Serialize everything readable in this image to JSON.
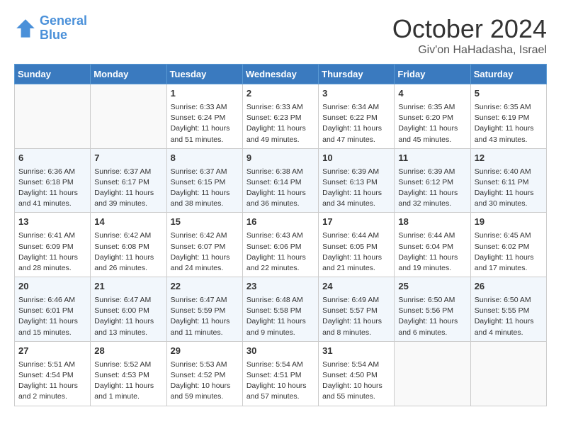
{
  "header": {
    "logo_line1": "General",
    "logo_line2": "Blue",
    "month_title": "October 2024",
    "location": "Giv'on HaHadasha, Israel"
  },
  "days_of_week": [
    "Sunday",
    "Monday",
    "Tuesday",
    "Wednesday",
    "Thursday",
    "Friday",
    "Saturday"
  ],
  "weeks": [
    [
      {
        "day": "",
        "info": ""
      },
      {
        "day": "",
        "info": ""
      },
      {
        "day": "1",
        "info": "Sunrise: 6:33 AM\nSunset: 6:24 PM\nDaylight: 11 hours and 51 minutes."
      },
      {
        "day": "2",
        "info": "Sunrise: 6:33 AM\nSunset: 6:23 PM\nDaylight: 11 hours and 49 minutes."
      },
      {
        "day": "3",
        "info": "Sunrise: 6:34 AM\nSunset: 6:22 PM\nDaylight: 11 hours and 47 minutes."
      },
      {
        "day": "4",
        "info": "Sunrise: 6:35 AM\nSunset: 6:20 PM\nDaylight: 11 hours and 45 minutes."
      },
      {
        "day": "5",
        "info": "Sunrise: 6:35 AM\nSunset: 6:19 PM\nDaylight: 11 hours and 43 minutes."
      }
    ],
    [
      {
        "day": "6",
        "info": "Sunrise: 6:36 AM\nSunset: 6:18 PM\nDaylight: 11 hours and 41 minutes."
      },
      {
        "day": "7",
        "info": "Sunrise: 6:37 AM\nSunset: 6:17 PM\nDaylight: 11 hours and 39 minutes."
      },
      {
        "day": "8",
        "info": "Sunrise: 6:37 AM\nSunset: 6:15 PM\nDaylight: 11 hours and 38 minutes."
      },
      {
        "day": "9",
        "info": "Sunrise: 6:38 AM\nSunset: 6:14 PM\nDaylight: 11 hours and 36 minutes."
      },
      {
        "day": "10",
        "info": "Sunrise: 6:39 AM\nSunset: 6:13 PM\nDaylight: 11 hours and 34 minutes."
      },
      {
        "day": "11",
        "info": "Sunrise: 6:39 AM\nSunset: 6:12 PM\nDaylight: 11 hours and 32 minutes."
      },
      {
        "day": "12",
        "info": "Sunrise: 6:40 AM\nSunset: 6:11 PM\nDaylight: 11 hours and 30 minutes."
      }
    ],
    [
      {
        "day": "13",
        "info": "Sunrise: 6:41 AM\nSunset: 6:09 PM\nDaylight: 11 hours and 28 minutes."
      },
      {
        "day": "14",
        "info": "Sunrise: 6:42 AM\nSunset: 6:08 PM\nDaylight: 11 hours and 26 minutes."
      },
      {
        "day": "15",
        "info": "Sunrise: 6:42 AM\nSunset: 6:07 PM\nDaylight: 11 hours and 24 minutes."
      },
      {
        "day": "16",
        "info": "Sunrise: 6:43 AM\nSunset: 6:06 PM\nDaylight: 11 hours and 22 minutes."
      },
      {
        "day": "17",
        "info": "Sunrise: 6:44 AM\nSunset: 6:05 PM\nDaylight: 11 hours and 21 minutes."
      },
      {
        "day": "18",
        "info": "Sunrise: 6:44 AM\nSunset: 6:04 PM\nDaylight: 11 hours and 19 minutes."
      },
      {
        "day": "19",
        "info": "Sunrise: 6:45 AM\nSunset: 6:02 PM\nDaylight: 11 hours and 17 minutes."
      }
    ],
    [
      {
        "day": "20",
        "info": "Sunrise: 6:46 AM\nSunset: 6:01 PM\nDaylight: 11 hours and 15 minutes."
      },
      {
        "day": "21",
        "info": "Sunrise: 6:47 AM\nSunset: 6:00 PM\nDaylight: 11 hours and 13 minutes."
      },
      {
        "day": "22",
        "info": "Sunrise: 6:47 AM\nSunset: 5:59 PM\nDaylight: 11 hours and 11 minutes."
      },
      {
        "day": "23",
        "info": "Sunrise: 6:48 AM\nSunset: 5:58 PM\nDaylight: 11 hours and 9 minutes."
      },
      {
        "day": "24",
        "info": "Sunrise: 6:49 AM\nSunset: 5:57 PM\nDaylight: 11 hours and 8 minutes."
      },
      {
        "day": "25",
        "info": "Sunrise: 6:50 AM\nSunset: 5:56 PM\nDaylight: 11 hours and 6 minutes."
      },
      {
        "day": "26",
        "info": "Sunrise: 6:50 AM\nSunset: 5:55 PM\nDaylight: 11 hours and 4 minutes."
      }
    ],
    [
      {
        "day": "27",
        "info": "Sunrise: 5:51 AM\nSunset: 4:54 PM\nDaylight: 11 hours and 2 minutes."
      },
      {
        "day": "28",
        "info": "Sunrise: 5:52 AM\nSunset: 4:53 PM\nDaylight: 11 hours and 1 minute."
      },
      {
        "day": "29",
        "info": "Sunrise: 5:53 AM\nSunset: 4:52 PM\nDaylight: 10 hours and 59 minutes."
      },
      {
        "day": "30",
        "info": "Sunrise: 5:54 AM\nSunset: 4:51 PM\nDaylight: 10 hours and 57 minutes."
      },
      {
        "day": "31",
        "info": "Sunrise: 5:54 AM\nSunset: 4:50 PM\nDaylight: 10 hours and 55 minutes."
      },
      {
        "day": "",
        "info": ""
      },
      {
        "day": "",
        "info": ""
      }
    ]
  ]
}
